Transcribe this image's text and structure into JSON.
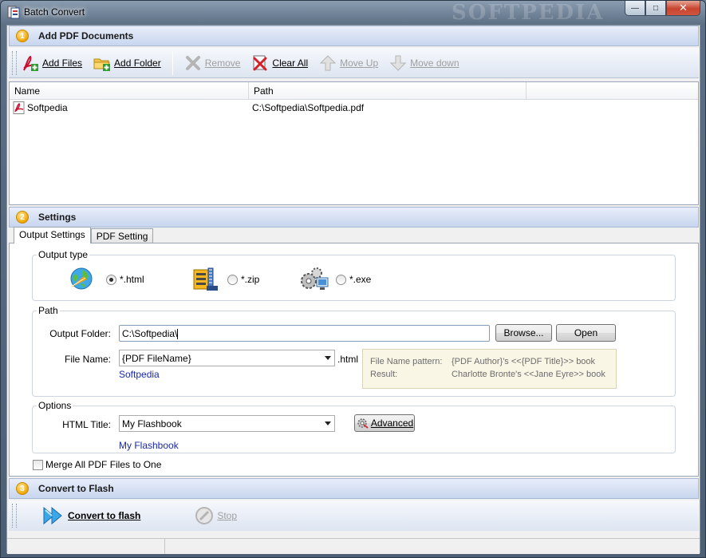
{
  "window": {
    "title": "Batch Convert",
    "watermark": "SOFTPEDIA"
  },
  "section1": {
    "number": "1",
    "title": "Add PDF Documents"
  },
  "toolbar": {
    "add_files": "Add Files",
    "add_folder": "Add Folder",
    "remove": "Remove",
    "clear_all": "Clear All",
    "move_up": "Move Up",
    "move_down": "Move down"
  },
  "filelist": {
    "headers": {
      "name": "Name",
      "path": "Path"
    },
    "rows": [
      {
        "name": "Softpedia",
        "path": "C:\\Softpedia\\Softpedia.pdf"
      }
    ]
  },
  "section2": {
    "number": "2",
    "title": "Settings"
  },
  "tabs": {
    "output": "Output Settings",
    "pdf": "PDF Setting"
  },
  "output_type": {
    "label": "Output type",
    "html": "*.html",
    "zip": "*.zip",
    "exe": "*.exe",
    "selected": "html"
  },
  "path": {
    "label": "Path",
    "output_folder_label": "Output Folder:",
    "output_folder_value": "C:\\Softpedia\\",
    "browse": "Browse...",
    "open": "Open",
    "file_name_label": "File Name:",
    "file_name_value": "{PDF FileName}",
    "ext": ".html",
    "file_name_preview": "Softpedia",
    "pattern_label": "File Name pattern:",
    "pattern_value": "{PDF Author}'s <<{PDF Title}>> book",
    "result_label": "Result:",
    "result_value": "Charlotte Bronte's <<Jane Eyre>> book"
  },
  "options": {
    "label": "Options",
    "html_title_label": "HTML Title:",
    "html_title_value": "My Flashbook",
    "html_title_preview": "My Flashbook",
    "advanced": "Advanced"
  },
  "merge": {
    "label": "Merge All PDF Files to One",
    "checked": false
  },
  "section3": {
    "number": "3",
    "title": "Convert to Flash"
  },
  "convert": {
    "convert_label": "Convert to flash",
    "stop_label": "Stop"
  },
  "colors": {
    "accent": "#f0a400",
    "header_bg": "#c8d6ee",
    "link": "#1a2aa8"
  }
}
